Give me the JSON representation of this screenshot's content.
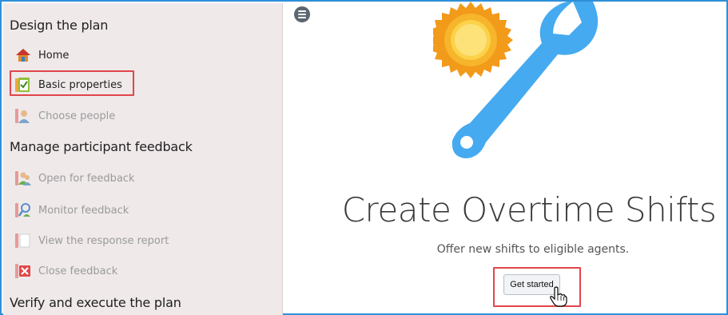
{
  "sidebar": {
    "sections": [
      {
        "title": "Design the plan"
      },
      {
        "title": "Manage participant feedback"
      },
      {
        "title": "Verify and execute the plan"
      }
    ],
    "items": [
      {
        "label": "Home",
        "icon": "home-icon",
        "enabled": true
      },
      {
        "label": "Basic properties",
        "icon": "checklist-icon",
        "enabled": true,
        "highlighted": true
      },
      {
        "label": "Choose people",
        "icon": "person-icon",
        "enabled": false
      },
      {
        "label": "Open for feedback",
        "icon": "people-icon",
        "enabled": false
      },
      {
        "label": "Monitor feedback",
        "icon": "magnifier-person-icon",
        "enabled": false
      },
      {
        "label": "View the response report",
        "icon": "document-icon",
        "enabled": false
      },
      {
        "label": "Close feedback",
        "icon": "close-x-icon",
        "enabled": false
      }
    ]
  },
  "main": {
    "title": "Create Overtime Shifts",
    "subtitle": "Offer new shifts to eligible agents.",
    "get_started_label": "Get started",
    "illustration": [
      "sun-icon",
      "wrench-icon"
    ]
  },
  "colors": {
    "sidebar_bg": "#efe9ea",
    "highlight": "#e0464b",
    "frame": "#2f8fd8",
    "wrench": "#3fa9f5",
    "sun": "#f7a21b"
  }
}
